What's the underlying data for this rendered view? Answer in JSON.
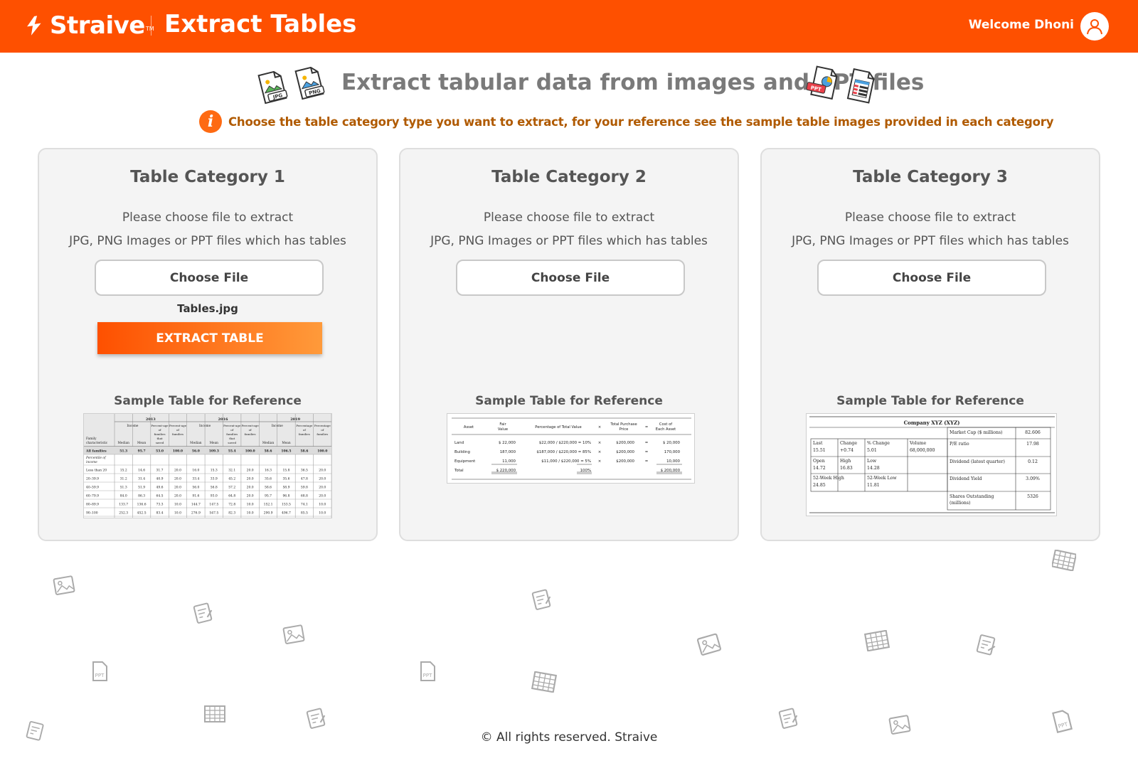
{
  "header": {
    "brand": "Straive",
    "brand_tm": "TM",
    "app_title": "Extract Tables",
    "welcome": "Welcome Dhoni",
    "accent_color": "#fe5000"
  },
  "hero": {
    "title": "Extract tabular data from images and PPT files",
    "info": "Choose the table category type you want to extract, for your reference see the sample table images provided in each category",
    "icons": [
      "jpg-file-icon",
      "png-file-icon",
      "ppt-file-icon",
      "spreadsheet-file-icon"
    ],
    "jpg_label": "JPG",
    "png_label": "PNG",
    "ppt_label": "PPT"
  },
  "cards": [
    {
      "title": "Table Category 1",
      "line1": "Please choose file to extract",
      "line2": "JPG, PNG Images or PPT files which has tables",
      "choose_label": "Choose File",
      "file_name": "Tables.jpg",
      "extract_label": "EXTRACT TABLE",
      "sample_label": "Sample Table for Reference"
    },
    {
      "title": "Table Category 2",
      "line1": "Please choose file to extract",
      "line2": "JPG, PNG Images or PPT files which has tables",
      "choose_label": "Choose File",
      "sample_label": "Sample Table for Reference"
    },
    {
      "title": "Table Category 3",
      "line1": "Please choose file to extract",
      "line2": "JPG, PNG Images or PPT files which has tables",
      "choose_label": "Choose File",
      "sample_label": "Sample Table for Reference"
    }
  ],
  "sample1": {
    "years": [
      "2013",
      "2016",
      "2019"
    ],
    "group_heads": [
      "Income",
      "Percent-age of families that saved",
      "Percent-age of families"
    ],
    "last_head": "Percentage of families",
    "row_label_head": "Family characteristic",
    "sub_heads": [
      "Median",
      "Mean"
    ],
    "rows": [
      [
        "All families",
        "51.3",
        "95.7",
        "53.0",
        "100.0",
        "56.0",
        "109.3",
        "55.4",
        "100.0",
        "58.6",
        "106.5",
        "58.6",
        "100.0"
      ],
      [
        "Percentile of income",
        "",
        "",
        "",
        "",
        "",
        "",
        "",
        "",
        "",
        "",
        "",
        ""
      ],
      [
        "Less than 20",
        "15.2",
        "14.6",
        "31.7",
        "20.0",
        "16.0",
        "15.3",
        "32.1",
        "20.0",
        "16.3",
        "15.8",
        "36.5",
        "20.0"
      ],
      [
        "20–39.9",
        "31.2",
        "31.4",
        "40.9",
        "20.0",
        "33.4",
        "33.9",
        "45.2",
        "20.0",
        "35.6",
        "35.6",
        "47.8",
        "20.0"
      ],
      [
        "40–59.9",
        "51.3",
        "51.9",
        "49.6",
        "20.0",
        "56.0",
        "56.8",
        "57.2",
        "20.0",
        "58.6",
        "58.9",
        "59.8",
        "20.0"
      ],
      [
        "60–79.9",
        "84.0",
        "86.3",
        "64.5",
        "20.0",
        "91.6",
        "93.0",
        "64.8",
        "20.0",
        "95.7",
        "96.8",
        "68.8",
        "20.0"
      ],
      [
        "80–89.9",
        "133.7",
        "136.6",
        "73.3",
        "10.0",
        "144.7",
        "147.5",
        "72.8",
        "10.0",
        "152.1",
        "153.5",
        "74.1",
        "10.0"
      ],
      [
        "90–100",
        "252.3",
        "452.5",
        "83.4",
        "10.0",
        "276.9",
        "547.5",
        "82.3",
        "10.0",
        "290.9",
        "496.7",
        "85.5",
        "10.0"
      ]
    ]
  },
  "sample2": {
    "heads": [
      "Asset",
      "Fair Value",
      "Percentage of Total Value",
      "×",
      "Total Purchase Price",
      "=",
      "Cost of Each Asset"
    ],
    "rows": [
      [
        "Land",
        "$  22,000",
        "$22,000 / $220,000 = 10%",
        "×",
        "$200,000",
        "=",
        "$  20,000"
      ],
      [
        "Building",
        "187,000",
        "$187,000 / $220,000 = 85%",
        "×",
        "$200,000",
        "=",
        "170,000"
      ],
      [
        "Equipment",
        "11,000",
        "$11,000 / $220,000 =  5%",
        "×",
        "$200,000",
        "=",
        "10,000"
      ],
      [
        "Total",
        "$ 220,000",
        "100%",
        "",
        "",
        "",
        "$ 200,000"
      ]
    ]
  },
  "sample3": {
    "title": "Company XYZ (XYZ)",
    "left_rows": [
      [
        "Last\n15.51",
        "Change\n+0.74",
        "% Change\n5.01",
        "Volume\n68,000,000"
      ],
      [
        "Open\n14.72",
        "High\n16.83",
        "Low\n14.28",
        ""
      ],
      [
        "52-Week High\n24.85",
        "",
        "52-Week Low\n11.81",
        ""
      ]
    ],
    "right_rows": [
      [
        "Market Cap ($ millions)",
        "82.606"
      ],
      [
        "P/E ratio",
        "17.98"
      ],
      [
        "Dividend (latest quarter)",
        "0.12"
      ],
      [
        "Dividend Yield",
        "3.09%"
      ],
      [
        "Shares Outstanding (millions)",
        "5326"
      ]
    ]
  },
  "footer": "© All rights reserved. Straive"
}
